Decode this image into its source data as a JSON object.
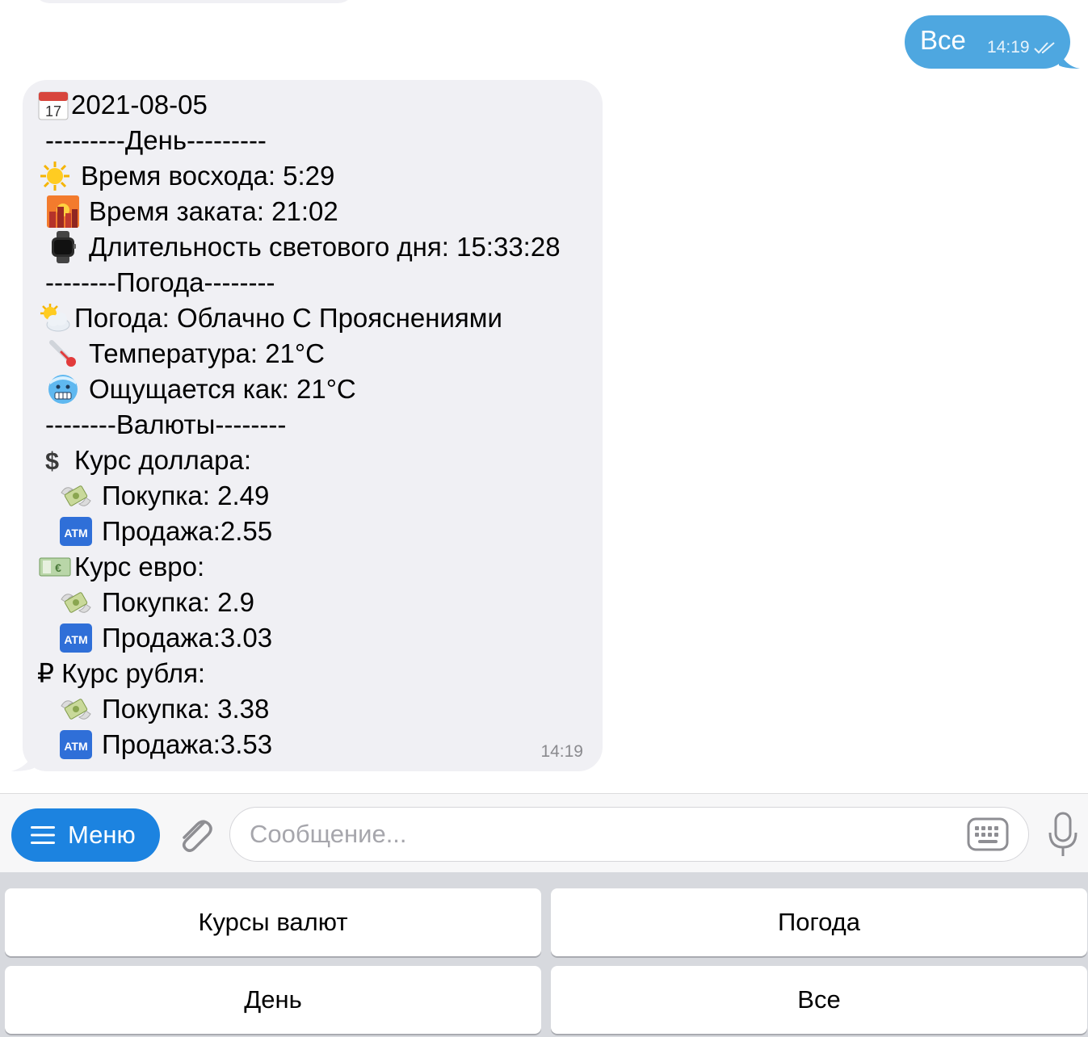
{
  "outgoing": {
    "text": "Все",
    "time": "14:19",
    "read": "double-check-icon"
  },
  "incoming": {
    "time": "14:19",
    "lines": [
      {
        "icon": "calendar-icon",
        "text": "2021-08-05"
      },
      {
        "icon": "",
        "text": "---------День---------"
      },
      {
        "icon": "sun-icon",
        "text": "Время восхода: 5:29"
      },
      {
        "icon": "sunset-city-icon",
        "text": "Время заката: 21:02"
      },
      {
        "icon": "watch-icon",
        "text": "Длительность светового дня: 15:33:28"
      },
      {
        "icon": "",
        "text": "--------Погода--------"
      },
      {
        "icon": "sun-behind-cloud-icon",
        "text": "Погода: Облачно С Прояснениями"
      },
      {
        "icon": "thermometer-icon",
        "text": "Температура: 21°C"
      },
      {
        "icon": "cold-face-icon",
        "text": "Ощущается как: 21°C"
      },
      {
        "icon": "",
        "text": "--------Валюты--------"
      },
      {
        "icon": "dollar-sign-icon",
        "text": "Курс доллара:"
      },
      {
        "icon": "money-wings-icon",
        "text": "Покупка: 2.49"
      },
      {
        "icon": "atm-icon",
        "text": "Продажа:2.55"
      },
      {
        "icon": "euro-banknote-icon",
        "text": "Курс евро:"
      },
      {
        "icon": "money-wings-icon",
        "text": "Покупка: 2.9"
      },
      {
        "icon": "atm-icon",
        "text": "Продажа:3.03"
      },
      {
        "icon": "",
        "text": "₽ Курс рубля:"
      },
      {
        "icon": "money-wings-icon",
        "text": "Покупка: 3.38"
      },
      {
        "icon": "atm-icon",
        "text": "Продажа:3.53"
      }
    ]
  },
  "input_bar": {
    "menu_label": "Меню",
    "placeholder": "Сообщение..."
  },
  "keyboard": {
    "buttons": [
      "Курсы валют",
      "Погода",
      "День",
      "Все"
    ]
  },
  "colors": {
    "outgoing_bubble": "#4ea7e0",
    "incoming_bubble": "#f0f0f4",
    "menu_button": "#1c83e0",
    "keyboard_bg": "#d7d9de"
  }
}
